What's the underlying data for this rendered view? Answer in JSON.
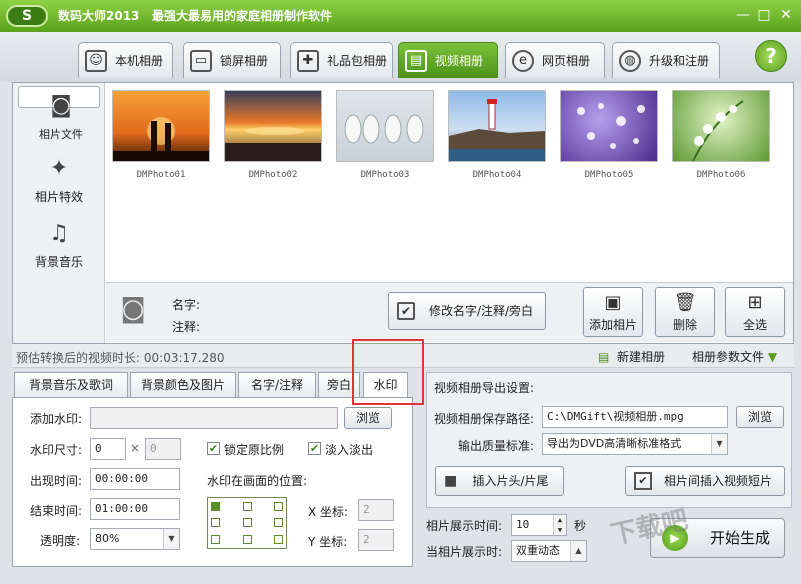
{
  "window": {
    "title": "数码大师2013",
    "slogan": "最强大最易用的家庭相册制作软件",
    "logo_text": "S",
    "minimize": "—",
    "maximize": "□",
    "close": "✕"
  },
  "tabs": [
    {
      "label": "本机相册",
      "icon": "user-frame-icon"
    },
    {
      "label": "锁屏相册",
      "icon": "monitor-icon"
    },
    {
      "label": "礼品包相册",
      "icon": "gift-icon"
    },
    {
      "label": "视频相册",
      "icon": "film-icon",
      "active": true
    },
    {
      "label": "网页相册",
      "icon": "ie-browser-icon"
    },
    {
      "label": "升级和注册",
      "icon": "globe-icon"
    }
  ],
  "help": "?",
  "sidebar": [
    {
      "label": "相片文件",
      "icon": "camera-icon",
      "selected": true
    },
    {
      "label": "相片特效",
      "icon": "effects-icon"
    },
    {
      "label": "背景音乐",
      "icon": "music-note-icon"
    }
  ],
  "photos": [
    {
      "name": "DMPhoto01"
    },
    {
      "name": "DMPhoto02"
    },
    {
      "name": "DMPhoto03"
    },
    {
      "name": "DMPhoto04"
    },
    {
      "name": "DMPhoto05"
    },
    {
      "name": "DMPhoto06"
    }
  ],
  "info": {
    "name_label": "名字:",
    "note_label": "注释:",
    "edit_button": "修改名字/注释/旁白"
  },
  "actions": {
    "add": "添加相片",
    "delete": "删除",
    "select_all": "全选"
  },
  "status": {
    "duration_label": "预估转换后的视频时长:",
    "duration": "00:03:17.280",
    "new_album": "新建相册",
    "param_file": "相册参数文件"
  },
  "lower_tabs": [
    "背景音乐及歌词",
    "背景颜色及图片",
    "名字/注释",
    "旁白",
    "水印"
  ],
  "watermark_settings": {
    "add_label": "添加水印:",
    "browse": "浏览",
    "size_label": "水印尺寸:",
    "size_w": "0",
    "size_x": "×",
    "size_h": "0",
    "lock_ratio": "锁定原比例",
    "fade": "淡入淡出",
    "appear_label": "出现时间:",
    "appear": "00:00:00",
    "position_label": "水印在画面的位置:",
    "end_label": "结束时间:",
    "end": "01:00:00",
    "x_label": "X 坐标:",
    "x_value": "2",
    "opacity_label": "透明度:",
    "opacity": "80%",
    "y_label": "Y 坐标:",
    "y_value": "2"
  },
  "export": {
    "title": "视频相册导出设置:",
    "path_label": "视频相册保存路径:",
    "path": "C:\\DMGift\\视频相册.mpg",
    "browse": "浏览",
    "quality_label": "输出质量标准:",
    "quality": "导出为DVD高清晰标准格式",
    "insert_head": "插入片头/片尾",
    "insert_between": "相片间插入视频短片"
  },
  "timing": {
    "show_label": "相片展示时间:",
    "show_value": "10",
    "unit": "秒",
    "transition_label": "当相片展示时:",
    "transition": "双重动态"
  },
  "start": "开始生成",
  "watermark_overlay": "下载吧"
}
